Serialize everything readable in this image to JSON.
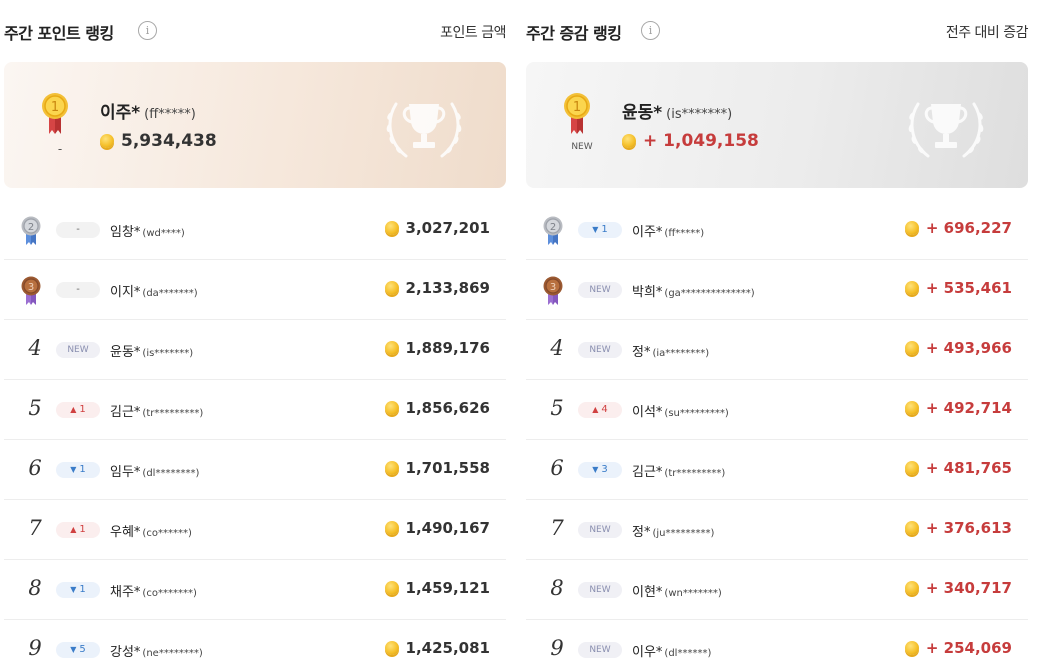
{
  "weekly_points": {
    "title": "주간 포인트 랭킹",
    "info_icon": "i",
    "subtitle": "포인트 금액",
    "top": {
      "rank_change": "-",
      "name": "이주*",
      "masked_id": "(ff*****)",
      "points": "5,934,438"
    },
    "rows": [
      {
        "rank": "2",
        "change": "-",
        "name": "임창*",
        "masked_id": "(wd****)",
        "points": "3,027,201"
      },
      {
        "rank": "3",
        "change": "-",
        "name": "이지*",
        "masked_id": "(da*******)",
        "points": "2,133,869"
      },
      {
        "rank": "4",
        "change": "NEW",
        "name": "윤동*",
        "masked_id": "(is*******)",
        "points": "1,889,176"
      },
      {
        "rank": "5",
        "change": "1",
        "name": "김근*",
        "masked_id": "(tr*********)",
        "points": "1,856,626"
      },
      {
        "rank": "6",
        "change": "1",
        "name": "임두*",
        "masked_id": "(dl********)",
        "points": "1,701,558"
      },
      {
        "rank": "7",
        "change": "1",
        "name": "우혜*",
        "masked_id": "(co******)",
        "points": "1,490,167"
      },
      {
        "rank": "8",
        "change": "1",
        "name": "채주*",
        "masked_id": "(co*******)",
        "points": "1,459,121"
      },
      {
        "rank": "9",
        "change": "5",
        "name": "강성*",
        "masked_id": "(ne********)",
        "points": "1,425,081"
      }
    ]
  },
  "weekly_change": {
    "title": "주간 증감 랭킹",
    "info_icon": "i",
    "subtitle": "전주 대비 증감",
    "top": {
      "rank_change": "NEW",
      "name": "윤동*",
      "masked_id": "(is*******)",
      "points": "+ 1,049,158"
    },
    "rows": [
      {
        "rank": "2",
        "change": "1",
        "name": "이주*",
        "masked_id": "(ff*****)",
        "points": "+ 696,227"
      },
      {
        "rank": "3",
        "change": "NEW",
        "name": "박희*",
        "masked_id": "(ga**************)",
        "points": "+ 535,461"
      },
      {
        "rank": "4",
        "change": "NEW",
        "name": "정*",
        "masked_id": "(ia********)",
        "points": "+ 493,966"
      },
      {
        "rank": "5",
        "change": "4",
        "name": "이석*",
        "masked_id": "(su*********)",
        "points": "+ 492,714"
      },
      {
        "rank": "6",
        "change": "3",
        "name": "김근*",
        "masked_id": "(tr*********)",
        "points": "+ 481,765"
      },
      {
        "rank": "7",
        "change": "NEW",
        "name": "정*",
        "masked_id": "(ju*********)",
        "points": "+ 376,613"
      },
      {
        "rank": "8",
        "change": "NEW",
        "name": "이현*",
        "masked_id": "(wn*******)",
        "points": "+ 340,717"
      },
      {
        "rank": "9",
        "change": "NEW",
        "name": "이우*",
        "masked_id": "(dl******)",
        "points": "+ 254,069"
      }
    ]
  },
  "colors": {
    "positive_red": "#c63c3c",
    "up_red": "#d04040",
    "down_blue": "#3a7cc8",
    "new_gray": "#8a8fb0"
  },
  "icons": {
    "gold_medal": "medal-1",
    "silver_medal": "medal-2",
    "bronze_medal": "medal-3",
    "coin": "coin",
    "trophy": "trophy-wreath"
  }
}
